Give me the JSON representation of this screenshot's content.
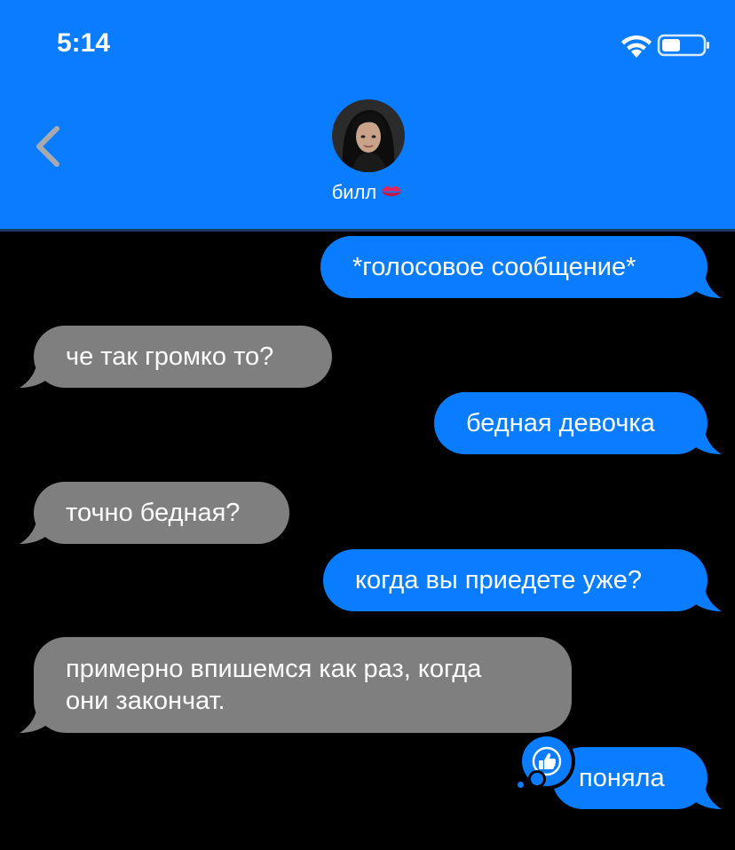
{
  "status_bar": {
    "time": "5:14",
    "wifi_icon": "wifi-icon",
    "battery_icon": "battery-icon",
    "battery_level": 0.45
  },
  "header": {
    "back_icon": "chevron-left-icon",
    "contact_name": "билл",
    "contact_emoji": "kiss-mark-icon",
    "background_color": "#0a7cff"
  },
  "messages": [
    {
      "direction": "outgoing",
      "text": "*голосовое сообщение*"
    },
    {
      "direction": "incoming",
      "text": "че так громко то?"
    },
    {
      "direction": "outgoing",
      "text": "бедная девочка"
    },
    {
      "direction": "incoming",
      "text": "точно бедная?"
    },
    {
      "direction": "outgoing",
      "text": "когда вы приедете уже?"
    },
    {
      "direction": "incoming",
      "text": "примерно впишемся как раз, когда\nони закончат."
    },
    {
      "direction": "outgoing",
      "text": "поняла",
      "reaction": "thumbs-up-icon"
    }
  ],
  "colors": {
    "outgoing_bubble": "#0a7cff",
    "incoming_bubble": "#7f7f7f",
    "background": "#000000",
    "text": "#ffffff"
  }
}
